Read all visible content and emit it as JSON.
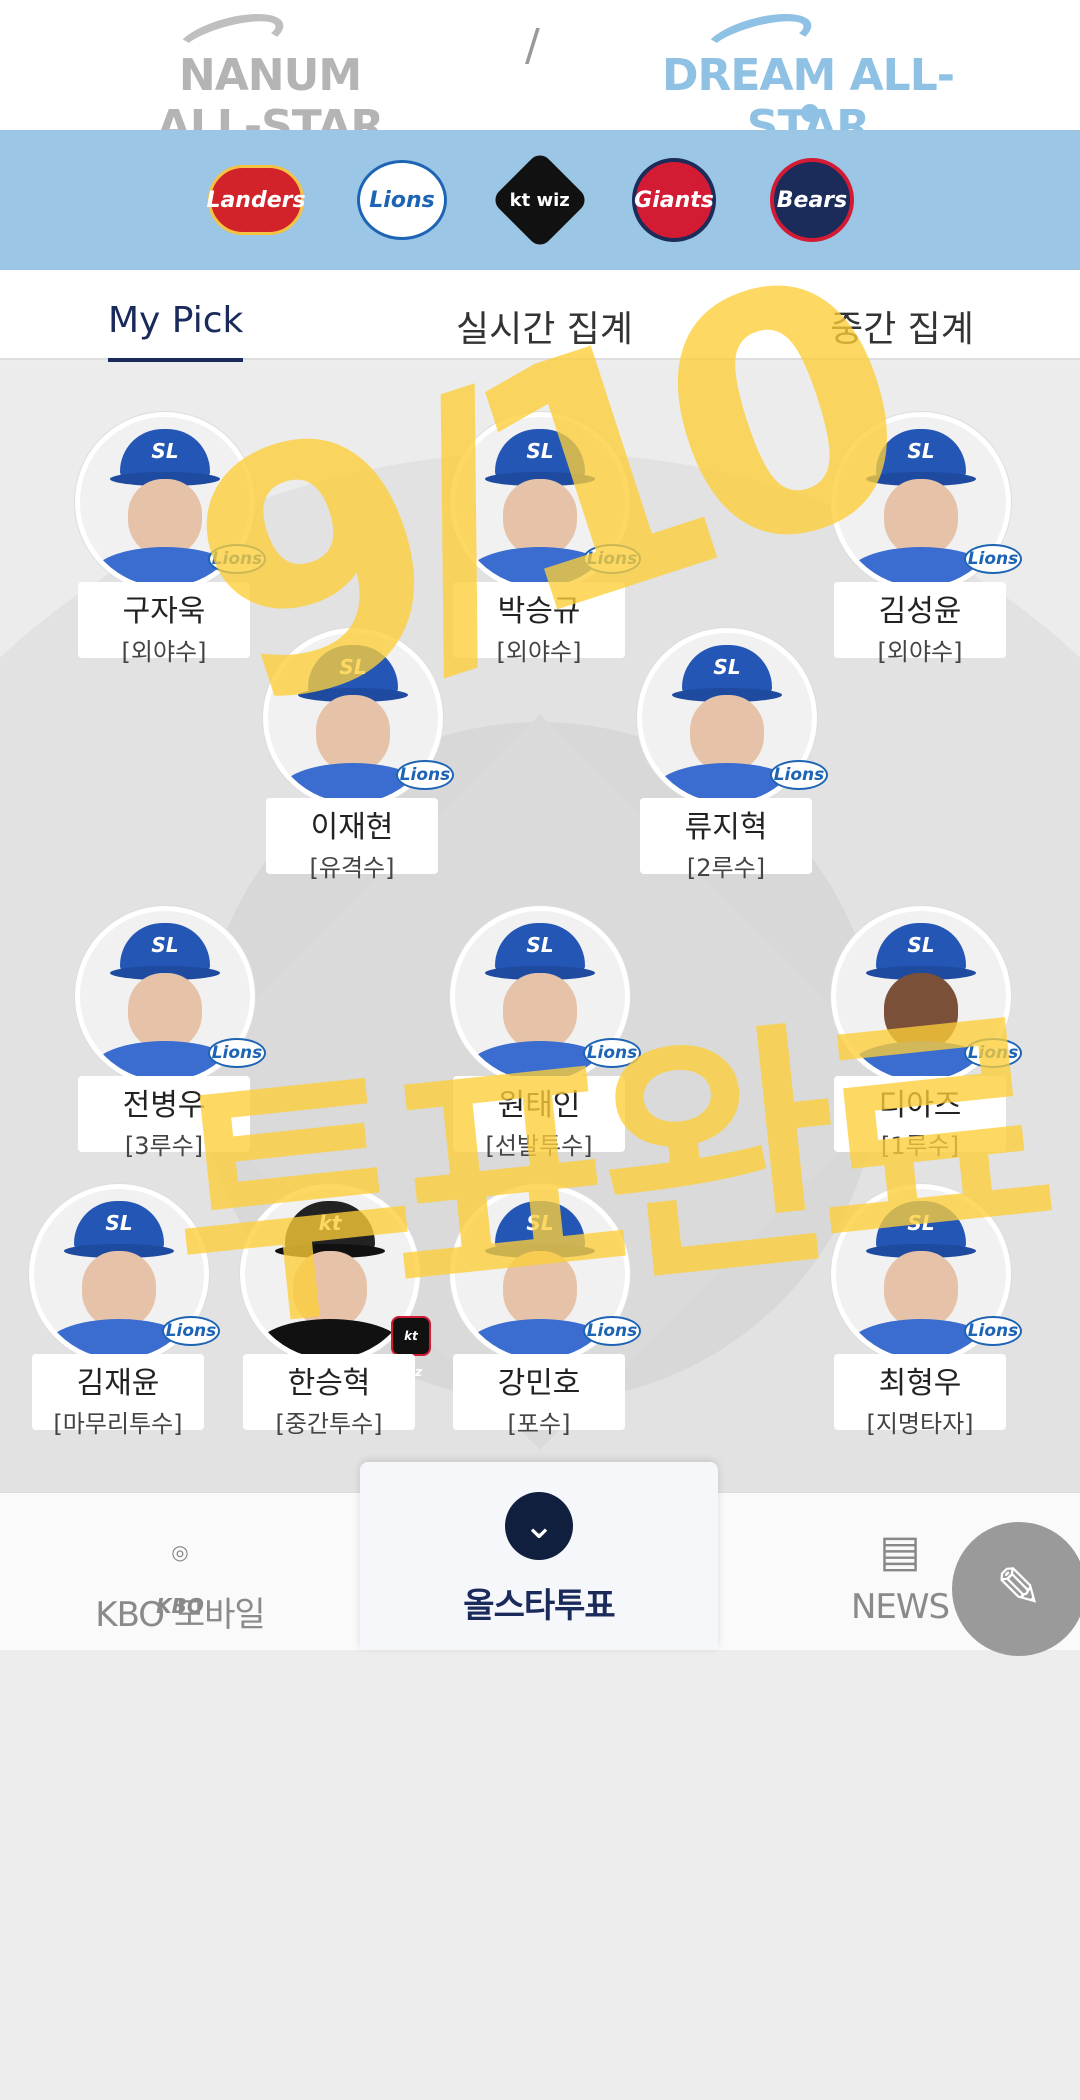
{
  "header": {
    "nanum_logo": "NANUM ALL-STAR",
    "separator": "/",
    "dream_logo": "DREAM ALL-STAR"
  },
  "teams": [
    {
      "name": "Landers",
      "icon": "ssg-landers-logo"
    },
    {
      "name": "Lions",
      "icon": "samsung-lions-logo"
    },
    {
      "name": "kt wiz",
      "icon": "kt-wiz-logo"
    },
    {
      "name": "Giants",
      "icon": "lotte-giants-logo"
    },
    {
      "name": "Bears",
      "icon": "doosan-bears-logo"
    }
  ],
  "tabs": [
    {
      "label": "My Pick",
      "active": true
    },
    {
      "label": "실시간 집계",
      "active": false
    },
    {
      "label": "중간 집계",
      "active": false
    }
  ],
  "players": [
    {
      "name": "구자욱",
      "position": "[외야수]",
      "team": "Lions"
    },
    {
      "name": "박승규",
      "position": "[외야수]",
      "team": "Lions"
    },
    {
      "name": "김성윤",
      "position": "[외야수]",
      "team": "Lions"
    },
    {
      "name": "이재현",
      "position": "[유격수]",
      "team": "Lions"
    },
    {
      "name": "류지혁",
      "position": "[2루수]",
      "team": "Lions"
    },
    {
      "name": "전병우",
      "position": "[3루수]",
      "team": "Lions"
    },
    {
      "name": "원태인",
      "position": "[선발투수]",
      "team": "Lions"
    },
    {
      "name": "디아즈",
      "position": "[1루수]",
      "team": "Lions"
    },
    {
      "name": "김재윤",
      "position": "[마무리투수]",
      "team": "Lions"
    },
    {
      "name": "한승혁",
      "position": "[중간투수]",
      "team": "kt wiz"
    },
    {
      "name": "강민호",
      "position": "[포수]",
      "team": "Lions"
    },
    {
      "name": "최형우",
      "position": "[지명타자]",
      "team": "Lions"
    }
  ],
  "handwriting": {
    "top": "9/10",
    "bottom": "투표완료"
  },
  "bottom_nav": {
    "kbo_label": "KBO 모바일",
    "kbo_icon_text": "KBO",
    "allstar_label": "올스타투표",
    "news_label": "NEWS"
  },
  "colors": {
    "team_bar": "#9cc6e6",
    "active_tab": "#1a2a5a",
    "highlight": "#fcce38"
  }
}
